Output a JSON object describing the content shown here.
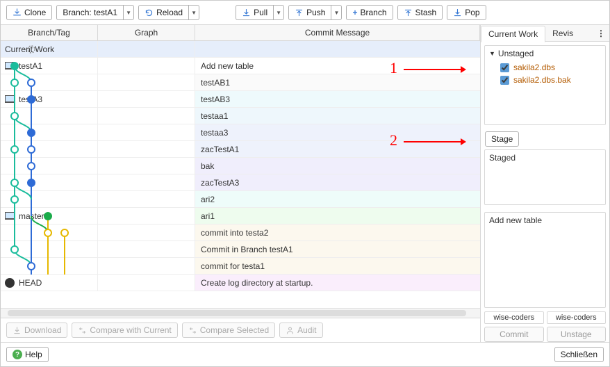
{
  "toolbar": {
    "clone": "Clone",
    "branch_selector": "Branch: testA1",
    "reload": "Reload",
    "pull": "Pull",
    "push": "Push",
    "new_branch": "Branch",
    "stash": "Stash",
    "pop": "Pop"
  },
  "headers": {
    "branch_tag": "Branch/Tag",
    "graph": "Graph",
    "commit_message": "Commit Message"
  },
  "rows": [
    {
      "branch": "Current Work",
      "msg": "",
      "icon": "dotted"
    },
    {
      "branch": "testA1",
      "msg": "Add new table",
      "icon": "monitor"
    },
    {
      "branch": "",
      "msg": "testAB1"
    },
    {
      "branch": "testA3",
      "msg": "testAB3",
      "icon": "monitor"
    },
    {
      "branch": "",
      "msg": "testaa1"
    },
    {
      "branch": "",
      "msg": "testaa3"
    },
    {
      "branch": "",
      "msg": "zacTestA1"
    },
    {
      "branch": "",
      "msg": "bak"
    },
    {
      "branch": "",
      "msg": "zacTestA3"
    },
    {
      "branch": "",
      "msg": "ari2"
    },
    {
      "branch": "master",
      "msg": "ari1",
      "icon": "monitor"
    },
    {
      "branch": "",
      "msg": "commit into testa2"
    },
    {
      "branch": "",
      "msg": "Commit in Branch testA1"
    },
    {
      "branch": "",
      "msg": "commit for testa1"
    },
    {
      "branch": "HEAD",
      "msg": "Create log directory at startup.",
      "icon": "github"
    }
  ],
  "left_actions": {
    "download": "Download",
    "compare_current": "Compare with Current",
    "compare_selected": "Compare Selected",
    "audit": "Audit"
  },
  "right": {
    "tabs": {
      "current": "Current Work",
      "revis": "Revis"
    },
    "unstaged_header": "Unstaged",
    "files": [
      "sakila2.dbs",
      "sakila2.dbs.bak"
    ],
    "stage_btn": "Stage",
    "staged_header": "Staged",
    "commit_message": "Add new table",
    "tags": [
      "wise-coders",
      "wise-coders"
    ],
    "commit": "Commit",
    "unstage": "Unstage"
  },
  "annotations": {
    "one": "1",
    "two": "2"
  },
  "footer": {
    "help": "Help",
    "close": "Schließen"
  }
}
